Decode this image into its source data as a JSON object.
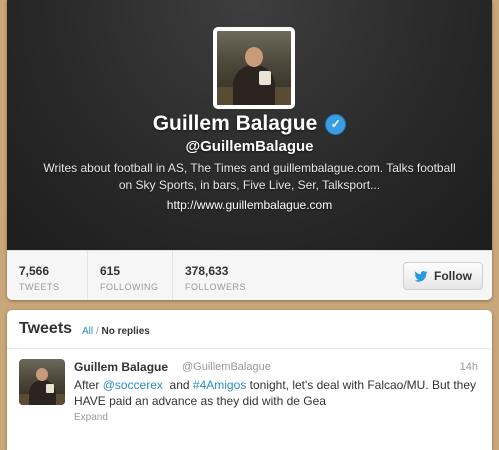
{
  "profile": {
    "name": "Guillem Balague",
    "screen_name": "@GuillemBalague",
    "bio": "Writes about football in AS, The Times and guillembalague.com. Talks football on Sky Sports, in bars, Five Live, Ser, Talksport...",
    "url": "http://www.guillembalague.com",
    "verified_icon": "verified-check-icon"
  },
  "stats": [
    {
      "value": "7,566",
      "label": "TWEETS"
    },
    {
      "value": "615",
      "label": "FOLLOWING"
    },
    {
      "value": "378,633",
      "label": "FOLLOWERS"
    }
  ],
  "follow_button": {
    "label": "Follow",
    "icon": "twitter-bird-icon"
  },
  "timeline": {
    "title": "Tweets",
    "filter_all": "All",
    "filter_sep": "/",
    "filter_noreplies": "No replies"
  },
  "tweet": {
    "name": "Guillem Balague",
    "handle": "@GuillemBalague",
    "time": "14h",
    "text_before": "After ",
    "mention": "@soccerex",
    "text_mid": "  and ",
    "hashtag": "#4Amigos",
    "text_after": " tonight, let's deal with Falcao/MU. But they HAVE paid an advance as they did with de Gea",
    "expand": "Expand"
  },
  "colors": {
    "background": "#c9a77a",
    "link": "#2a8ec4",
    "verified": "#3a9de0",
    "twitter_blue": "#2a9ae0"
  }
}
